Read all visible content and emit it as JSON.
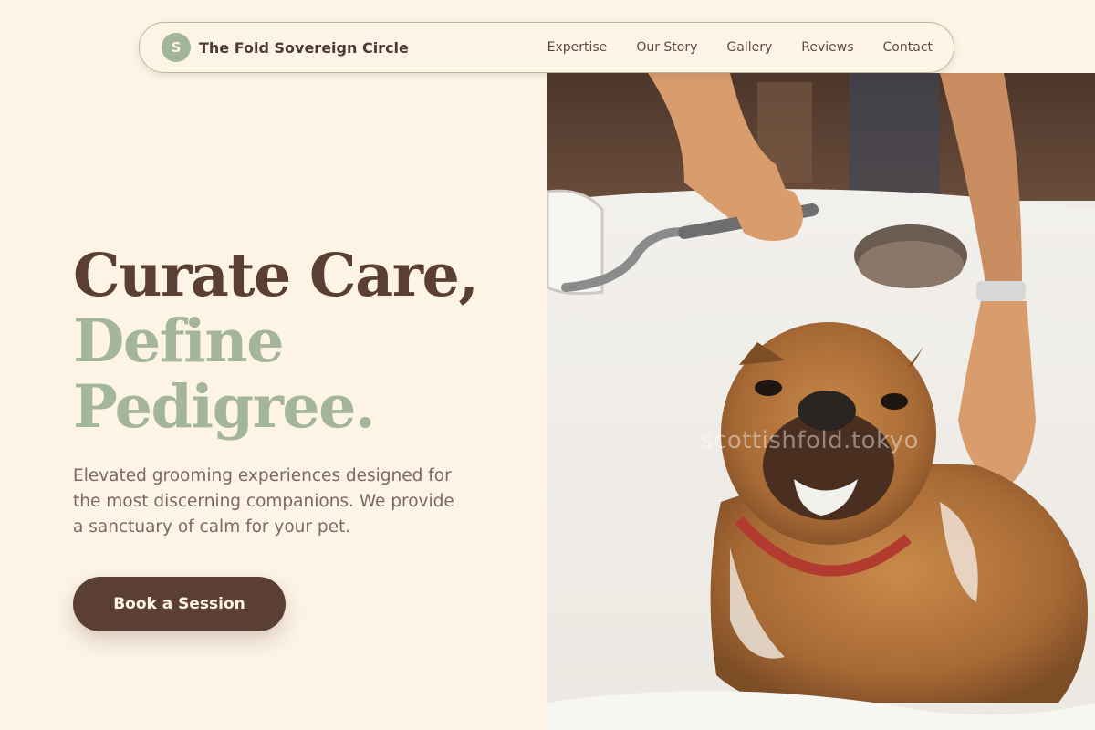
{
  "brand": {
    "initial": "S",
    "name": "The Fold Sovereign Circle"
  },
  "nav": {
    "links": [
      "Expertise",
      "Our Story",
      "Gallery",
      "Reviews",
      "Contact"
    ]
  },
  "hero": {
    "headline_line1": "Curate Care,",
    "headline_line2": "Define",
    "headline_line3": "Pedigree.",
    "lede": "Elevated grooming experiences designed for the most discerning companions. We provide a sanctuary of calm for your pet.",
    "cta_label": "Book a Session",
    "photo_watermark": "scottishfold.tokyo"
  },
  "colors": {
    "background": "#fdf4e6",
    "primary_brown": "#5b3f35",
    "sage": "#a3b59a",
    "body_text": "#7a6960"
  }
}
